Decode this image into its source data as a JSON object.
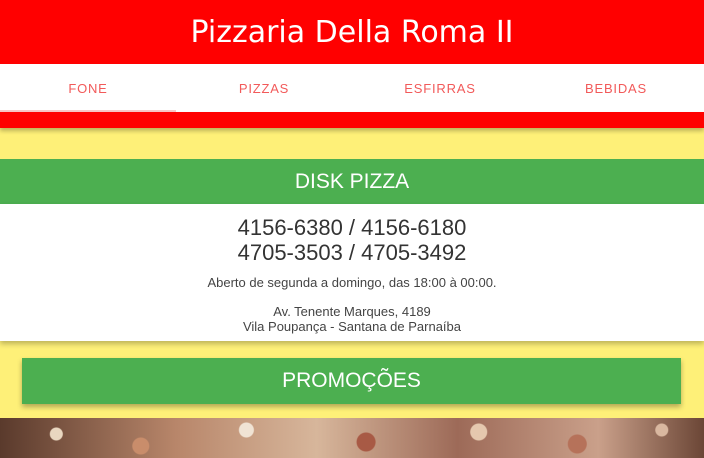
{
  "header": {
    "title": "Pizzaria Della Roma II"
  },
  "tabs": [
    {
      "label": "FONE",
      "active": true
    },
    {
      "label": "PIZZAS",
      "active": false
    },
    {
      "label": "ESFIRRAS",
      "active": false
    },
    {
      "label": "BEBIDAS",
      "active": false
    }
  ],
  "disk": {
    "title": "DISK PIZZA",
    "phones": [
      "4156-6380 / 4156-6180",
      "4705-3503 / 4705-3492"
    ],
    "hours": "Aberto de segunda a domingo, das 18:00 à 00:00.",
    "address_line1": "Av. Tenente Marques, 4189",
    "address_line2": "Vila Poupança - Santana de Parnaíba"
  },
  "promo": {
    "label": "PROMOÇÕES"
  },
  "colors": {
    "header_red": "#ff0000",
    "tab_text": "#f25a5a",
    "section_green": "#4caf50",
    "background_yellow": "#fef078"
  }
}
